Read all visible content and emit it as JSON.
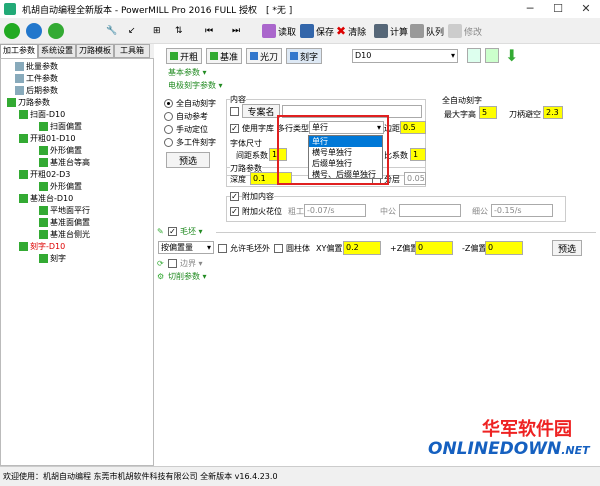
{
  "window": {
    "title": "机胡自动编程全新版本 - PowerMILL Pro 2016 FULL 授权　[ *无 ]"
  },
  "toolbar": {
    "read": "读取",
    "save": "保存",
    "clear": "清除",
    "calc": "计算",
    "queue": "队列",
    "modify": "修改"
  },
  "tabs": [
    "加工参数",
    "系统设置",
    "刀路模板",
    "工具箱"
  ],
  "tree": [
    {
      "label": "批量参数"
    },
    {
      "label": "工件参数"
    },
    {
      "label": "后期参数"
    },
    {
      "label": "刀路参数"
    },
    {
      "label": "扫面-D10"
    },
    {
      "label": "扫面偏置"
    },
    {
      "label": "开粗01-D10"
    },
    {
      "label": "外形偏置"
    },
    {
      "label": "基准台等高"
    },
    {
      "label": "开粗02-D3"
    },
    {
      "label": "外形偏置"
    },
    {
      "label": "基准台-D10"
    },
    {
      "label": "平地面平行"
    },
    {
      "label": "基准面偏置"
    },
    {
      "label": "基准台侧光"
    },
    {
      "label": "刻字-D10"
    },
    {
      "label": "刻字"
    }
  ],
  "righttop": {
    "open": "开粗",
    "base": "基准",
    "light": "光刀",
    "engrave": "刻字",
    "tool": "D10"
  },
  "sections": {
    "basic": "基本参数 ▾",
    "elec": "电极刻字参数 ▾",
    "blank": "毛坯 ▾",
    "border": "边界 ▾",
    "cut": "切削参数 ▾"
  },
  "radios": [
    "全自动刻字",
    "自动参考",
    "手动定位",
    "多工件刻字"
  ],
  "preview": "预选",
  "content": {
    "group": "内容",
    "special": "专案名",
    "uselib": "使用字库",
    "multitype": "多行类型",
    "selected": "单行",
    "edge": "边距",
    "edge_val": "0.5"
  },
  "dropdown": [
    "单行",
    "横号单独行",
    "后缀单独行",
    "横号、后缀单独行"
  ],
  "font": {
    "group": "字体尺寸",
    "spacing": "间距系数",
    "spacing_val": "1",
    "ratio": "比系数",
    "ratio_val": "1"
  },
  "auto": {
    "group": "全自动刻字",
    "maxh": "最大字高",
    "maxh_val": "5",
    "shank": "刀柄避空",
    "shank_val": "2.3"
  },
  "path": {
    "group": "刀路参数",
    "depth": "深度",
    "depth_val": "0.1",
    "layer": "分层",
    "layer_val": "0.05"
  },
  "extra": {
    "group": "附加内容",
    "fire": "附加火花位",
    "coarse": "粗工",
    "coarse_val": "-0.07/s",
    "mid": "中公",
    "fine": "细公",
    "fine_val": "-0.15/s"
  },
  "blank": {
    "mode": "按偏置量",
    "allow": "允许毛坯外",
    "cyl": "圆柱体",
    "xy": "XY偏置",
    "xy_val": "0.2",
    "zp": "+Z偏置",
    "zp_val": "0",
    "zm": "-Z偏置",
    "zm_val": "0",
    "preview": "预选"
  },
  "status": "欢迎使用：机胡自动编程 东莞市机胡软件科技有限公司 全新版本 v16.4.23.0",
  "logo": {
    "cn": "华军软件园",
    "en": "ONLINEDOWN",
    "dot": ".NET"
  },
  "colors": {
    "accent": "#0078d7",
    "yellow": "#ffff00",
    "red": "#e02020",
    "green": "#228b22"
  }
}
